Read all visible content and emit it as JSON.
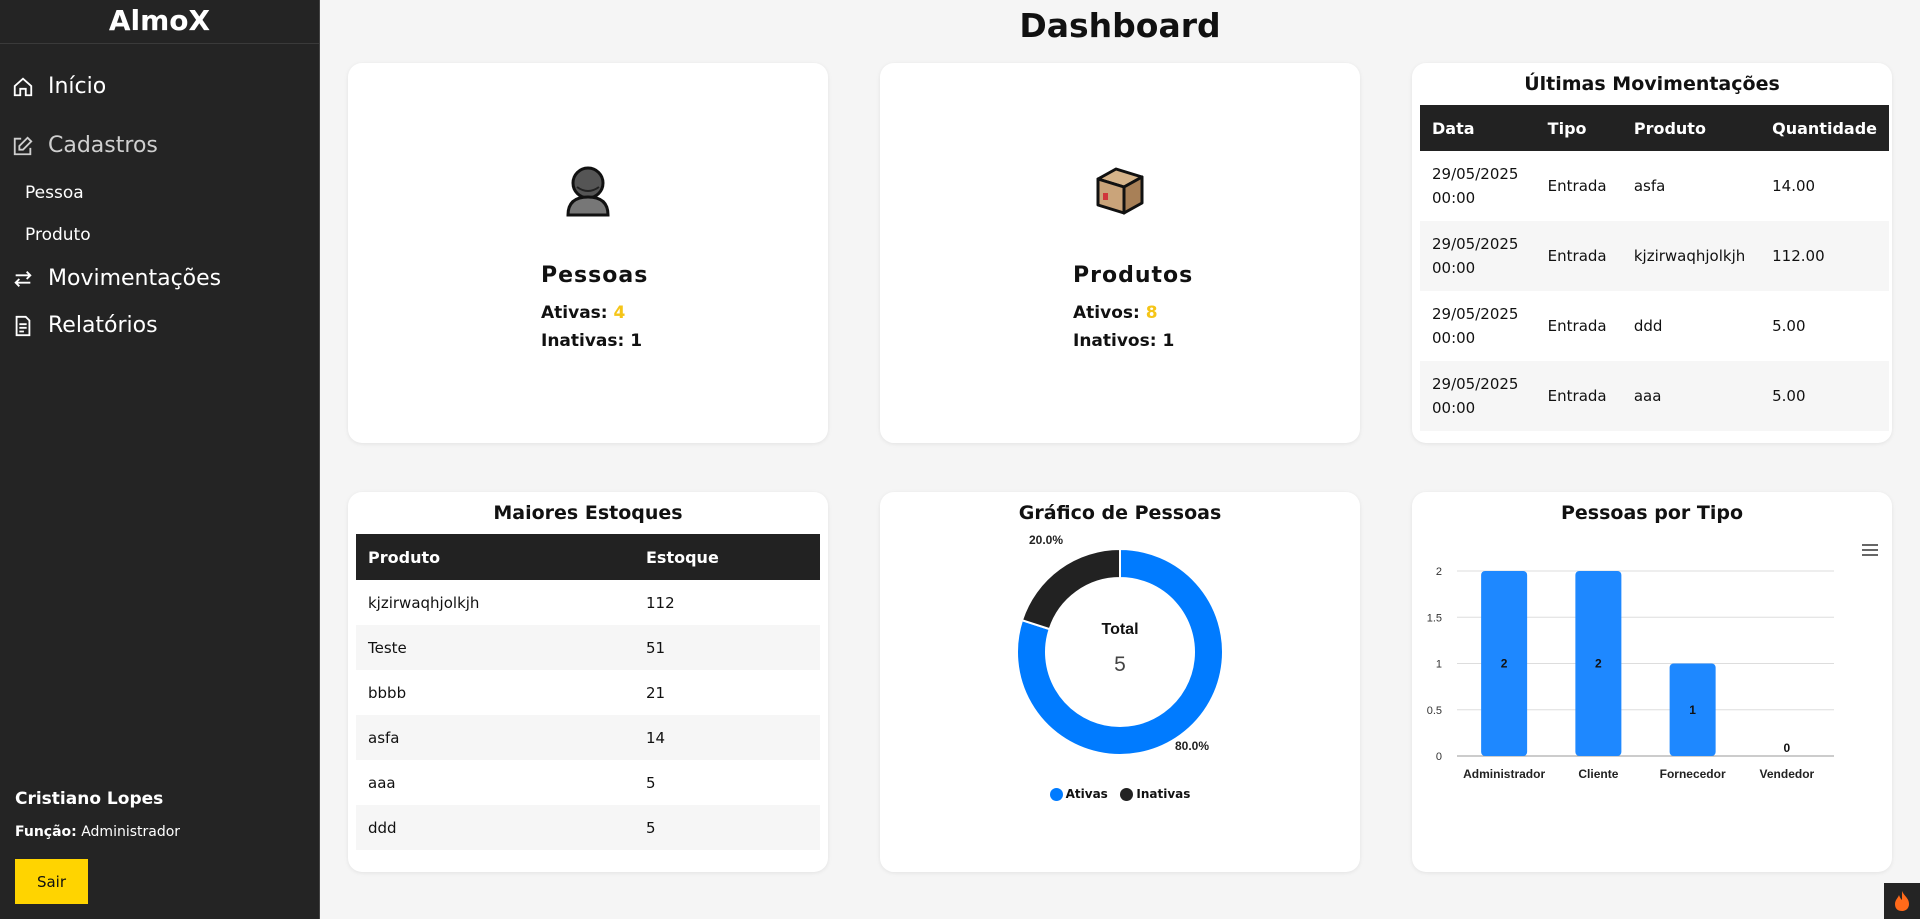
{
  "app": {
    "brand": "AlmoX",
    "page_title": "Dashboard"
  },
  "sidebar": {
    "items": [
      {
        "label": "Início",
        "icon": "home-icon"
      },
      {
        "label": "Cadastros",
        "icon": "edit-icon"
      },
      {
        "label": "Movimentações",
        "icon": "transfer-icon"
      },
      {
        "label": "Relatórios",
        "icon": "report-icon"
      }
    ],
    "sub_items": [
      "Pessoa",
      "Produto"
    ],
    "user": {
      "name": "Cristiano Lopes",
      "role_label": "Função:",
      "role": "Administrador"
    },
    "logout_label": "Sair"
  },
  "people_card": {
    "title": "Pessoas",
    "active_label": "Ativas:",
    "active": "4",
    "inactive_label": "Inativas:",
    "inactive": "1"
  },
  "products_card": {
    "title": "Produtos",
    "active_label": "Ativos:",
    "active": "8",
    "inactive_label": "Inativos:",
    "inactive": "1"
  },
  "movements": {
    "title": "Últimas Movimentações",
    "headers": [
      "Data",
      "Tipo",
      "Produto",
      "Quantidade"
    ],
    "rows": [
      [
        "29/05/2025",
        "00:00",
        "Entrada",
        "asfa",
        "14.00"
      ],
      [
        "29/05/2025",
        "00:00",
        "Entrada",
        "kjzirwaqhjolkjh",
        "112.00"
      ],
      [
        "29/05/2025",
        "00:00",
        "Entrada",
        "ddd",
        "5.00"
      ],
      [
        "29/05/2025",
        "00:00",
        "Entrada",
        "aaa",
        "5.00"
      ]
    ]
  },
  "stock": {
    "title": "Maiores Estoques",
    "headers": [
      "Produto",
      "Estoque"
    ],
    "rows": [
      [
        "kjzirwaqhjolkjh",
        "112"
      ],
      [
        "Teste",
        "51"
      ],
      [
        "bbbb",
        "21"
      ],
      [
        "asfa",
        "14"
      ],
      [
        "aaa",
        "5"
      ],
      [
        "ddd",
        "5"
      ]
    ]
  },
  "people_chart": {
    "title": "Gráfico de Pessoas",
    "center_label": "Total",
    "center_value": "5",
    "colors": {
      "Ativas": "#007bff",
      "Inativas": "#222222"
    }
  },
  "type_chart": {
    "title": "Pessoas por Tipo",
    "color": "#1e88ff"
  },
  "chart_data": [
    {
      "type": "pie",
      "categories": [
        "Ativas",
        "Inativas"
      ],
      "values": [
        4,
        1
      ],
      "data_labels": [
        "80.0%",
        "20.0%"
      ],
      "legend": "bottom"
    },
    {
      "type": "bar",
      "categories": [
        "Administrador",
        "Cliente",
        "Fornecedor",
        "Vendedor"
      ],
      "values": [
        2,
        2,
        1,
        0
      ],
      "ylim": [
        0,
        2
      ],
      "yticks": [
        "0",
        "0.5",
        "1",
        "1.5",
        "2"
      ],
      "grid": true
    }
  ]
}
